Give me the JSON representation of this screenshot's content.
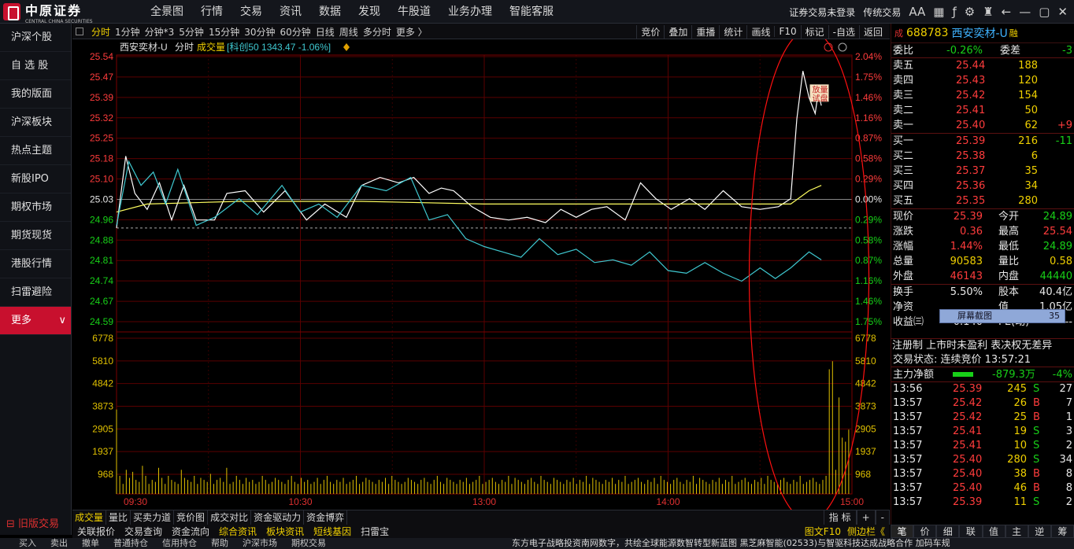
{
  "app": {
    "brand": "中原证券",
    "brand_sub": "CENTRAL CHINA SECURITIES"
  },
  "menu": [
    "全景图",
    "行情",
    "交易",
    "资讯",
    "数据",
    "发现",
    "牛股道",
    "业务办理",
    "智能客服"
  ],
  "top_right": {
    "login": "证券交易未登录",
    "mode": "传统交易",
    "font": "AA"
  },
  "sidebar": {
    "items": [
      "沪深个股",
      "自 选 股",
      "我的版面",
      "沪深板块",
      "热点主题",
      "新股IPO",
      "期权市场",
      "期货现货",
      "港股行情",
      "扫雷避险",
      "更多"
    ],
    "old_trade": "旧版交易"
  },
  "period_bar": {
    "items": [
      "分时",
      "1分钟",
      "分钟*3",
      "5分钟",
      "15分钟",
      "30分钟",
      "60分钟",
      "日线",
      "周线",
      "多分时",
      "更多 〉"
    ],
    "active": "分时",
    "right": [
      "竞价",
      "叠加",
      "重播",
      "统计",
      "画线",
      "F10",
      "标记",
      "-自选",
      "返回"
    ]
  },
  "chart_header": {
    "name": "西安奕材-U",
    "mode": "分时",
    "vol": "成交量",
    "index": "[科创50 1343.47 -1.06%]"
  },
  "chart_data": {
    "type": "line",
    "title": "西安奕材-U 分时",
    "prev_close": 25.03,
    "ylim": [
      24.52,
      25.54
    ],
    "y_ticks_left": [
      "25.54",
      "25.47",
      "25.39",
      "25.32",
      "25.25",
      "25.18",
      "25.10",
      "25.03",
      "24.96",
      "24.88",
      "24.81",
      "24.74",
      "24.67",
      "24.59"
    ],
    "y_ticks_right": [
      "2.04%",
      "1.75%",
      "1.46%",
      "1.16%",
      "0.87%",
      "0.58%",
      "0.29%",
      "0.00%",
      "0.29%",
      "0.58%",
      "0.87%",
      "1.16%",
      "1.46%",
      "1.75%"
    ],
    "vol_ticks": [
      "6778",
      "5810",
      "4842",
      "3873",
      "2905",
      "1937",
      "968"
    ],
    "vol_max": 7746,
    "x_ticks": [
      "09:30",
      "10:30",
      "13:00",
      "14:00",
      "15:00"
    ],
    "x_minutes": [
      0,
      240
    ],
    "series": [
      {
        "name": "价格",
        "color": "#ffffff",
        "points": [
          [
            0,
            24.89
          ],
          [
            3,
            25.16
          ],
          [
            6,
            25.02
          ],
          [
            10,
            24.96
          ],
          [
            14,
            25.06
          ],
          [
            18,
            24.92
          ],
          [
            22,
            25.05
          ],
          [
            26,
            24.92
          ],
          [
            32,
            24.92
          ],
          [
            36,
            25.02
          ],
          [
            42,
            25.03
          ],
          [
            48,
            24.95
          ],
          [
            55,
            25.03
          ],
          [
            62,
            24.92
          ],
          [
            68,
            24.98
          ],
          [
            75,
            24.93
          ],
          [
            80,
            25.05
          ],
          [
            86,
            25.08
          ],
          [
            92,
            25.06
          ],
          [
            97,
            25.08
          ],
          [
            102,
            25.02
          ],
          [
            106,
            25.04
          ],
          [
            110,
            25.03
          ],
          [
            116,
            24.97
          ],
          [
            122,
            24.93
          ],
          [
            128,
            24.92
          ],
          [
            134,
            24.93
          ],
          [
            140,
            24.91
          ],
          [
            145,
            24.96
          ],
          [
            150,
            24.93
          ],
          [
            155,
            24.96
          ],
          [
            160,
            24.97
          ],
          [
            166,
            24.92
          ],
          [
            171,
            25.06
          ],
          [
            176,
            25.0
          ],
          [
            181,
            24.96
          ],
          [
            187,
            25.0
          ],
          [
            192,
            24.96
          ],
          [
            198,
            25.03
          ],
          [
            204,
            24.97
          ],
          [
            210,
            24.96
          ],
          [
            216,
            24.97
          ],
          [
            220,
            25.0
          ],
          [
            222,
            25.3
          ],
          [
            224,
            25.48
          ],
          [
            226,
            25.38
          ],
          [
            228,
            25.32
          ],
          [
            229,
            25.4
          ],
          [
            230,
            25.35
          ]
        ]
      },
      {
        "name": "均价",
        "color": "#ffff60",
        "points": [
          [
            0,
            24.95
          ],
          [
            10,
            24.98
          ],
          [
            40,
            24.99
          ],
          [
            80,
            24.99
          ],
          [
            120,
            24.98
          ],
          [
            160,
            24.98
          ],
          [
            200,
            24.98
          ],
          [
            220,
            24.98
          ],
          [
            226,
            25.03
          ],
          [
            230,
            25.05
          ]
        ]
      },
      {
        "name": "科创50",
        "color": "#3fc8d0",
        "points": [
          [
            0,
            24.9
          ],
          [
            4,
            25.14
          ],
          [
            8,
            25.05
          ],
          [
            12,
            25.1
          ],
          [
            16,
            24.98
          ],
          [
            20,
            25.11
          ],
          [
            26,
            24.9
          ],
          [
            32,
            24.93
          ],
          [
            40,
            25.0
          ],
          [
            46,
            24.94
          ],
          [
            54,
            25.05
          ],
          [
            60,
            24.95
          ],
          [
            66,
            24.98
          ],
          [
            72,
            24.93
          ],
          [
            80,
            25.05
          ],
          [
            88,
            25.03
          ],
          [
            96,
            25.08
          ],
          [
            102,
            24.92
          ],
          [
            108,
            24.94
          ],
          [
            114,
            24.85
          ],
          [
            120,
            24.82
          ],
          [
            126,
            24.8
          ],
          [
            132,
            24.78
          ],
          [
            138,
            24.85
          ],
          [
            144,
            24.79
          ],
          [
            150,
            24.81
          ],
          [
            156,
            24.76
          ],
          [
            162,
            24.77
          ],
          [
            168,
            24.75
          ],
          [
            174,
            24.8
          ],
          [
            180,
            24.73
          ],
          [
            186,
            24.72
          ],
          [
            192,
            24.76
          ],
          [
            198,
            24.72
          ],
          [
            204,
            24.69
          ],
          [
            210,
            24.74
          ],
          [
            215,
            24.7
          ],
          [
            220,
            24.74
          ],
          [
            226,
            24.8
          ],
          [
            230,
            24.77
          ]
        ]
      }
    ],
    "volume": [
      4200,
      900,
      500,
      1200,
      800,
      1100,
      700,
      600,
      1400,
      900,
      500,
      700,
      600,
      1300,
      800,
      500,
      900,
      700,
      600,
      500,
      1200,
      800,
      700,
      600,
      900,
      500,
      800,
      700,
      600,
      1000,
      500,
      700,
      800,
      600,
      1300,
      500,
      600,
      900,
      700,
      500,
      800,
      600,
      700,
      500,
      600,
      900,
      700,
      500,
      600,
      800,
      700,
      600,
      500,
      700,
      900,
      600,
      500,
      800,
      600,
      700,
      500,
      600,
      800,
      500,
      700,
      900,
      600,
      500,
      700,
      600,
      800,
      500,
      600,
      700,
      900,
      500,
      600,
      800,
      700,
      600,
      500,
      700,
      600,
      800,
      500,
      900,
      700,
      600,
      500,
      600,
      800,
      700,
      600,
      500,
      700,
      800,
      600,
      500,
      700,
      900,
      600,
      500,
      800,
      700,
      600,
      500,
      700,
      600,
      800,
      500,
      600,
      700,
      900,
      500,
      600,
      700,
      800,
      600,
      500,
      700,
      600,
      900,
      500,
      800,
      700,
      600,
      500,
      700,
      800,
      600,
      500,
      900,
      700,
      600,
      500,
      800,
      700,
      600,
      500,
      700,
      600,
      800,
      500,
      700,
      600,
      900,
      500,
      800,
      700,
      600,
      500,
      700,
      600,
      800,
      500,
      700,
      600,
      900,
      500,
      600,
      700,
      800,
      600,
      500,
      700,
      600,
      800,
      500,
      900,
      700,
      600,
      500,
      700,
      800,
      600,
      500,
      700,
      600,
      900,
      500,
      800,
      700,
      600,
      500,
      700,
      600,
      800,
      500,
      700,
      600,
      900,
      500,
      600,
      700,
      800,
      600,
      500,
      700,
      600,
      800,
      500,
      900,
      700,
      600,
      500,
      700,
      800,
      600,
      500,
      700,
      600,
      900,
      500,
      600,
      700,
      800,
      600,
      500,
      700,
      900,
      6200,
      6600,
      1200,
      4800,
      2800,
      2600,
      3200
    ],
    "annotations": [
      "放量",
      "试盘"
    ]
  },
  "right_panel": {
    "prefix": "成",
    "code": "688783",
    "name": "西安奕材-U",
    "tag": "融",
    "weibi": {
      "label": "委比",
      "value": "-0.26%",
      "label2": "委差",
      "value2": "-3"
    },
    "asks": [
      {
        "label": "卖五",
        "price": "25.44",
        "vol": "188",
        "chg": ""
      },
      {
        "label": "卖四",
        "price": "25.43",
        "vol": "120",
        "chg": ""
      },
      {
        "label": "卖三",
        "price": "25.42",
        "vol": "154",
        "chg": ""
      },
      {
        "label": "卖二",
        "price": "25.41",
        "vol": "50",
        "chg": ""
      },
      {
        "label": "卖一",
        "price": "25.40",
        "vol": "62",
        "chg": "+9"
      }
    ],
    "bids": [
      {
        "label": "买一",
        "price": "25.39",
        "vol": "216",
        "chg": "-11"
      },
      {
        "label": "买二",
        "price": "25.38",
        "vol": "6",
        "chg": ""
      },
      {
        "label": "买三",
        "price": "25.37",
        "vol": "35",
        "chg": ""
      },
      {
        "label": "买四",
        "price": "25.36",
        "vol": "34",
        "chg": ""
      },
      {
        "label": "买五",
        "price": "25.35",
        "vol": "280",
        "chg": ""
      }
    ],
    "quotes": [
      {
        "l1": "现价",
        "v1": "25.39",
        "c1": "red",
        "l2": "今开",
        "v2": "24.89",
        "c2": "grn"
      },
      {
        "l1": "涨跌",
        "v1": "0.36",
        "c1": "red",
        "l2": "最高",
        "v2": "25.54",
        "c2": "red"
      },
      {
        "l1": "涨幅",
        "v1": "1.44%",
        "c1": "red",
        "l2": "最低",
        "v2": "24.89",
        "c2": "grn"
      },
      {
        "l1": "总量",
        "v1": "90583",
        "c1": "yel",
        "l2": "量比",
        "v2": "0.58",
        "c2": "yel"
      },
      {
        "l1": "外盘",
        "v1": "46143",
        "c1": "red",
        "l2": "内盘",
        "v2": "44440",
        "c2": "grn"
      }
    ],
    "fin": [
      {
        "l1": "换手",
        "v1": "5.50%",
        "l2": "股本",
        "v2": "40.4亿"
      },
      {
        "l1": "净资",
        "v1": "",
        "l2": "值",
        "v2": "1.05亿"
      },
      {
        "l1": "收益㈢",
        "v1": "-0.140",
        "l2": "PE(动)",
        "v2": "--"
      }
    ],
    "popup": "屏幕截图",
    "popup_val": "35",
    "note": "注册制 上市时未盈利 表决权无差异",
    "status": "交易状态: 连续竞价 13:57:21",
    "main_flow": {
      "label": "主力净额",
      "value": "-879.3万",
      "pct": "-4%"
    },
    "ticks": [
      {
        "t": "13:56",
        "p": "25.39",
        "v": "245",
        "s": "S",
        "n": "27"
      },
      {
        "t": "13:57",
        "p": "25.42",
        "v": "26",
        "s": "B",
        "n": "7"
      },
      {
        "t": "13:57",
        "p": "25.42",
        "v": "25",
        "s": "B",
        "n": "1"
      },
      {
        "t": "13:57",
        "p": "25.41",
        "v": "19",
        "s": "S",
        "n": "3"
      },
      {
        "t": "13:57",
        "p": "25.41",
        "v": "10",
        "s": "S",
        "n": "2"
      },
      {
        "t": "13:57",
        "p": "25.40",
        "v": "280",
        "s": "S",
        "n": "34"
      },
      {
        "t": "13:57",
        "p": "25.40",
        "v": "38",
        "v_s": "",
        "s": "B",
        "n": "8"
      },
      {
        "t": "13:57",
        "p": "25.40",
        "v": "46",
        "s": "B",
        "n": "8"
      },
      {
        "t": "13:57",
        "p": "25.39",
        "v": "11",
        "s": "S",
        "n": "2"
      }
    ],
    "tabs": [
      "笔",
      "价",
      "细",
      "联",
      "值",
      "主",
      "逆",
      "筹"
    ]
  },
  "chart_tabs": [
    "成交量",
    "量比",
    "买卖力道",
    "竞价图",
    "成交对比",
    "资金驱动力",
    "资金博弈"
  ],
  "chart_tabs_right": [
    "指 标",
    "+",
    "-"
  ],
  "strip": [
    "关联报价",
    "交易查询",
    "资金流向",
    "综合资讯",
    "板块资讯",
    "短线基因",
    "扫雷宝"
  ],
  "strip_right": [
    "图文F10",
    "侧边栏《"
  ],
  "bottom": {
    "items": [
      "买入",
      "卖出",
      "撤单",
      "普通持仓",
      "信用持仓",
      "帮助",
      "沪深市场",
      "期权交易"
    ],
    "scroll": "东方电子战略投资南网数字，共绘全球能源数智转型新蓝图     黑芝麻智能(02533)与智驱科技达成战略合作 加码车规"
  }
}
